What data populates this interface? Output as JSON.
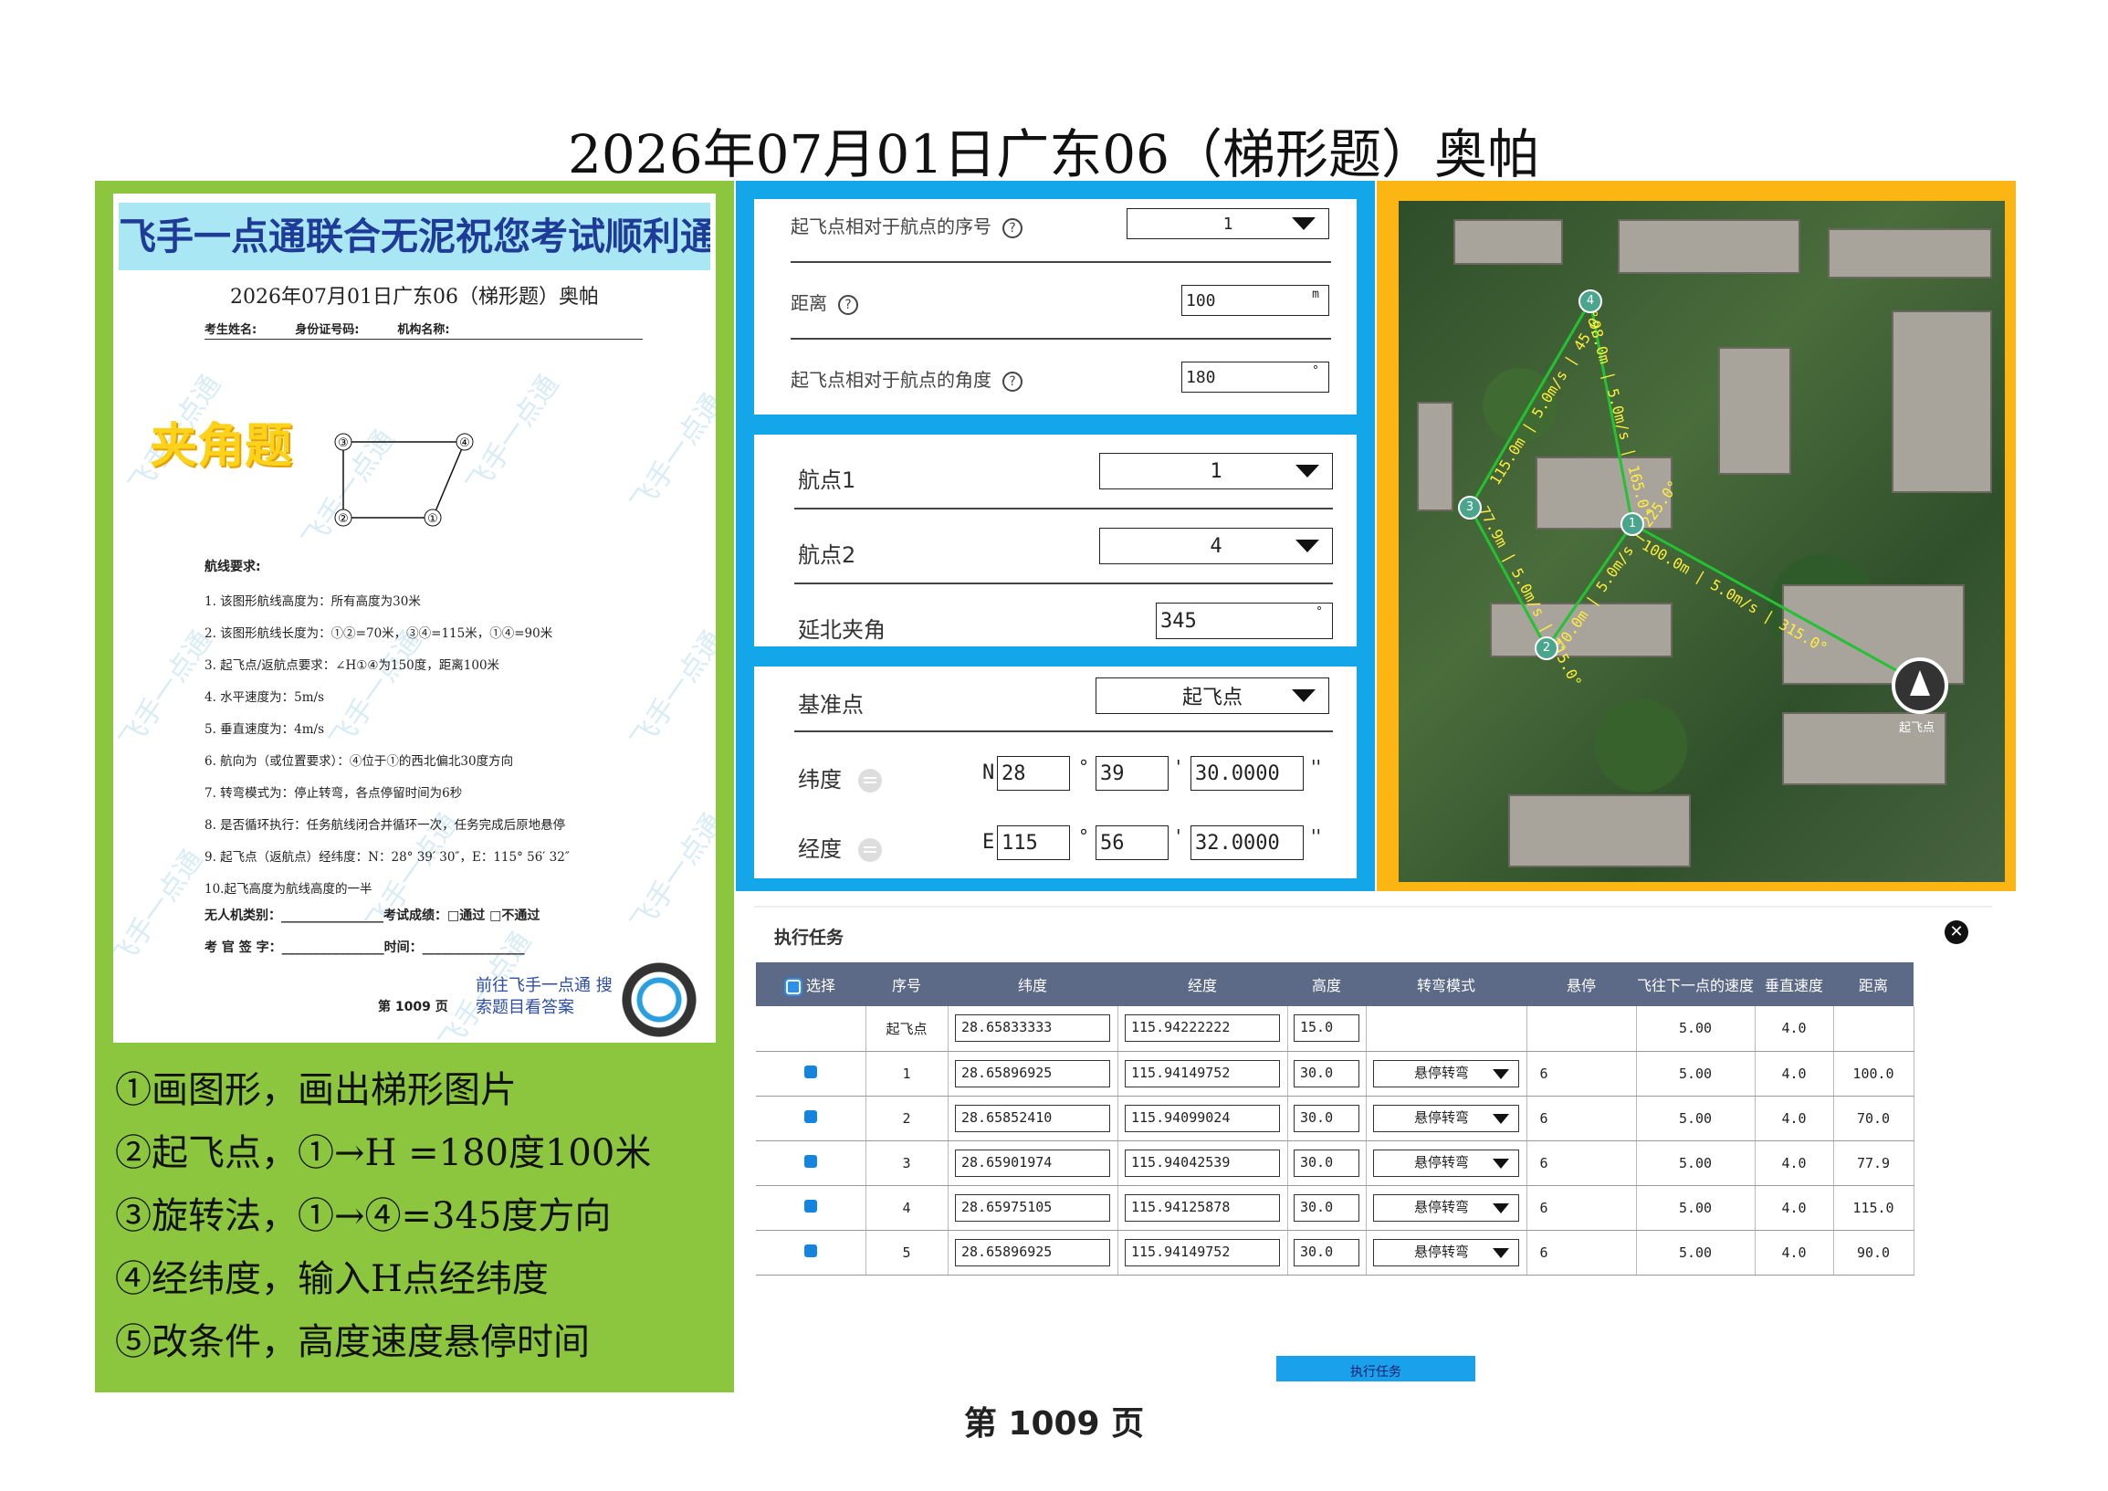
{
  "title": "2026年07月01日广东06（梯形题）奥帕",
  "exam_paper": {
    "banner": "飞手一点通联合无泥祝您考试顺利通过",
    "title": "2026年07月01日广东06（梯形题）奥帕",
    "info": {
      "name": "考生姓名:",
      "id": "身份证号码:",
      "org": "机构名称:"
    },
    "angle_label": "夹角题",
    "diagram_points": [
      "③",
      "④",
      "②",
      "①"
    ],
    "requirements_title": "航线要求:",
    "requirements": [
      "1. 该图形航线高度为：所有高度为30米",
      "2. 该图形航线长度为：①②=70米，③④=115米，①④=90米",
      "3. 起飞点/返航点要求：∠H①④为150度，距离100米",
      "4. 水平速度为：5m/s",
      "5. 垂直速度为：4m/s",
      "6. 航向为（或位置要求）：④位于①的西北偏北30度方向",
      "7. 转弯模式为：停止转弯，各点停留时间为6秒",
      "8. 是否循环执行：任务航线闭合并循环一次，任务完成后原地悬停",
      "9. 起飞点（返航点）经纬度：N：28° 39′ 30″，E：115° 56′ 32″",
      "10.起飞高度为航线高度的一半"
    ],
    "uav_type": "无人机类别：________________考试成绩：□通过  □不通过",
    "examiner": "考 官 签 字：________________时间：________________",
    "page": "第 1009 页",
    "promo": "前往飞手一点通 搜索题目看答案",
    "watermark": "飞手一点通"
  },
  "instructions": [
    "①画图形，画出梯形图片",
    "②起飞点，①→H =180度100米",
    "③旋转法，①→④=345度方向",
    "④经纬度，输入H点经纬度",
    "⑤改条件，高度速度悬停时间"
  ],
  "takeoff_panel": {
    "seq_label": "起飞点相对于航点的序号",
    "seq_value": "1",
    "dist_label": "距离",
    "dist_value": "100",
    "dist_unit": "m",
    "angle_label": "起飞点相对于航点的角度",
    "angle_value": "180",
    "angle_unit": "°",
    "help": "?"
  },
  "rotate_panel": {
    "wp1_label": "航点1",
    "wp1_value": "1",
    "wp2_label": "航点2",
    "wp2_value": "4",
    "north_label": "延北夹角",
    "north_value": "345",
    "north_unit": "°"
  },
  "coord_panel": {
    "ref_label": "基准点",
    "ref_value": "起飞点",
    "lat_label": "纬度",
    "lat_dir": "N",
    "lat_deg": "28",
    "lat_min": "39",
    "lat_sec": "30.0000",
    "lon_label": "经度",
    "lon_dir": "E",
    "lon_deg": "115",
    "lon_min": "56",
    "lon_sec": "32.0000",
    "deg_sym": "°",
    "min_sym": "'",
    "sec_sym": "''"
  },
  "map": {
    "waypoints": [
      "1",
      "2",
      "3",
      "4"
    ],
    "route_labels": [
      "98.0m | 5.0m/s | 165.0°",
      "115.0m | 5.0m/s | 45.0°",
      "77.9m | 5.0m/s | 315.0°",
      "70.0m | 5.0m/s | 225.0°",
      "100.0m | 5.0m/s | 315.0°"
    ],
    "home_label": "起飞点"
  },
  "task": {
    "title": "执行任务",
    "close": "✕",
    "columns": [
      "选择",
      "序号",
      "纬度",
      "经度",
      "高度",
      "转弯模式",
      "悬停",
      "飞往下一点的速度",
      "垂直速度",
      "距离"
    ],
    "rows": [
      {
        "seq": "起飞点",
        "lat": "28.65833333",
        "lon": "115.94222222",
        "alt": "15.0",
        "turn": "",
        "hover": "",
        "speed": "5.00",
        "vspeed": "4.0",
        "dist": ""
      },
      {
        "seq": "1",
        "lat": "28.65896925",
        "lon": "115.94149752",
        "alt": "30.0",
        "turn": "悬停转弯",
        "hover": "6",
        "speed": "5.00",
        "vspeed": "4.0",
        "dist": "100.0"
      },
      {
        "seq": "2",
        "lat": "28.65852410",
        "lon": "115.94099024",
        "alt": "30.0",
        "turn": "悬停转弯",
        "hover": "6",
        "speed": "5.00",
        "vspeed": "4.0",
        "dist": "70.0"
      },
      {
        "seq": "3",
        "lat": "28.65901974",
        "lon": "115.94042539",
        "alt": "30.0",
        "turn": "悬停转弯",
        "hover": "6",
        "speed": "5.00",
        "vspeed": "4.0",
        "dist": "77.9"
      },
      {
        "seq": "4",
        "lat": "28.65975105",
        "lon": "115.94125878",
        "alt": "30.0",
        "turn": "悬停转弯",
        "hover": "6",
        "speed": "5.00",
        "vspeed": "4.0",
        "dist": "115.0"
      },
      {
        "seq": "5",
        "lat": "28.65896925",
        "lon": "115.94149752",
        "alt": "30.0",
        "turn": "悬停转弯",
        "hover": "6",
        "speed": "5.00",
        "vspeed": "4.0",
        "dist": "90.0"
      }
    ],
    "exec_label": "执行任务"
  },
  "page_number": "第 1009 页",
  "colors": {
    "left": "#8cc63f",
    "mid": "#13a6e8",
    "right": "#fbb613",
    "route": "#22c232"
  }
}
